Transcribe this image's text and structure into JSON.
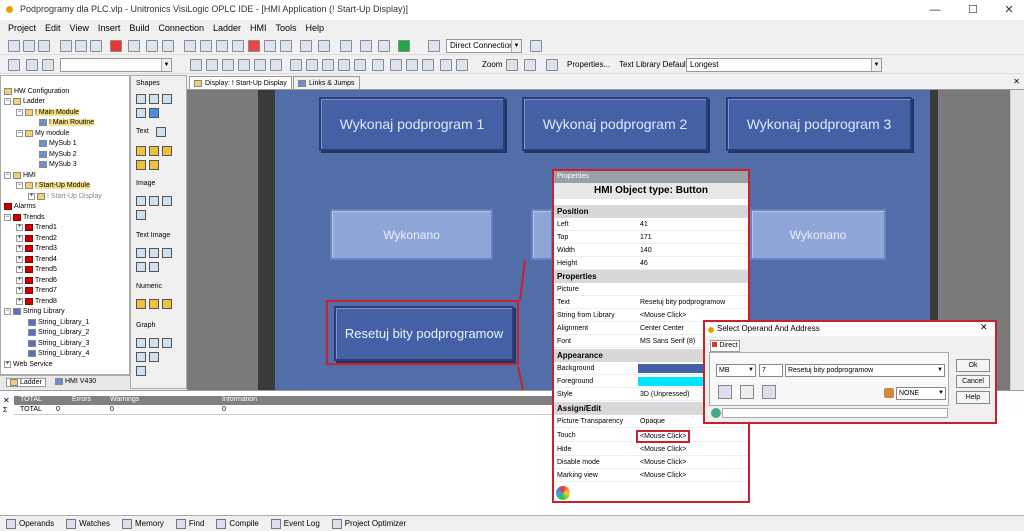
{
  "window": {
    "title": "Podprogramy dla PLC.vlp - Unitronics VisiLogic OPLC IDE - [HMI Application (! Start-Up Display)]"
  },
  "menu": [
    "Project",
    "Edit",
    "View",
    "Insert",
    "Build",
    "Connection",
    "Ladder",
    "HMI",
    "Tools",
    "Help"
  ],
  "toolbar": {
    "connection": "Direct Connection",
    "zoom_label": "Zoom",
    "properties_label": "Properties...",
    "text_library_label": "Text Library Default",
    "text_library_value": "Longest"
  },
  "tree": {
    "items": [
      "HW Configuration",
      "Ladder",
      "! Main Module",
      "! Main Routine",
      "My module",
      "MySub 1",
      "MySub 2",
      "MySub 3",
      "HMI",
      "! Start-Up Module",
      "! Start-Up Display",
      "Alarms",
      "Trends",
      "Trend1",
      "Trend2",
      "Trend3",
      "Trend4",
      "Trend5",
      "Trend6",
      "Trend7",
      "Trend8",
      "String Library",
      "String_Library_1",
      "String_Library_2",
      "String_Library_3",
      "String_Library_4",
      "Web Service"
    ],
    "tabs": [
      "Ladder",
      "HMI V430"
    ]
  },
  "shapes": {
    "title": "Shapes",
    "sections": [
      "Text",
      "Image",
      "Text Image",
      "Numeric",
      "Graph"
    ]
  },
  "doc_tabs": [
    "Display: ! Start-Up Display",
    "Links & Jumps"
  ],
  "canvas": {
    "buttons_top": [
      "Wykonaj podprogram 1",
      "Wykonaj podprogram 2",
      "Wykonaj podprogram 3"
    ],
    "buttons_mid": [
      "Wykonano",
      "Wykonano"
    ],
    "reset_button": "Resetuj bity podprogramow"
  },
  "output": {
    "headers": [
      "TOTAL",
      "Errors",
      "Warnings",
      "Information"
    ],
    "row": [
      "TOTAL",
      "0",
      "0",
      "0"
    ]
  },
  "statusbar": [
    "Operands",
    "Watches",
    "Memory",
    "Find",
    "Compile",
    "Event Log",
    "Project Optimizer"
  ],
  "properties": {
    "window_title": "Properties",
    "heading": "HMI Object type: Button",
    "sec_position": "Position",
    "left_k": "Left",
    "left_v": "41",
    "top_k": "Top",
    "top_v": "171",
    "width_k": "Width",
    "width_v": "140",
    "height_k": "Height",
    "height_v": "46",
    "sec_properties": "Properties",
    "picture_k": "Picture",
    "picture_v": "",
    "text_k": "Text",
    "text_v": "Resetuj bity podprogramow",
    "strlib_k": "String from Library",
    "strlib_v": "<Mouse Click>",
    "align_k": "Alignment",
    "align_v": "Center Center",
    "font_k": "Font",
    "font_v": "MS Sans Serif (8)",
    "sec_appearance": "Appearance",
    "bg_k": "Background",
    "bg_color": "#4461a6",
    "fg_k": "Foreground",
    "fg_color": "#00e5ff",
    "style_k": "Style",
    "style_v": "3D (Unpressed)",
    "sec_assign": "Assign/Edit",
    "transp_k": "Picture Transparency",
    "transp_v": "Opaque",
    "touch_k": "Touch",
    "touch_v": "<Mouse Click>",
    "hide_k": "Hide",
    "hide_v": "<Mouse Click>",
    "disable_k": "Disable mode",
    "disable_v": "<Mouse Click>",
    "marking_k": "Marking view",
    "marking_v": "<Mouse Click>"
  },
  "dialog": {
    "title": "Select Operand And Address",
    "tab": "Direct",
    "operand_type": "MB",
    "address": "7",
    "description": "Resetuj bity podprogramow",
    "none_value": "NONE",
    "ok": "Ok",
    "cancel": "Cancel",
    "help": "Help"
  }
}
